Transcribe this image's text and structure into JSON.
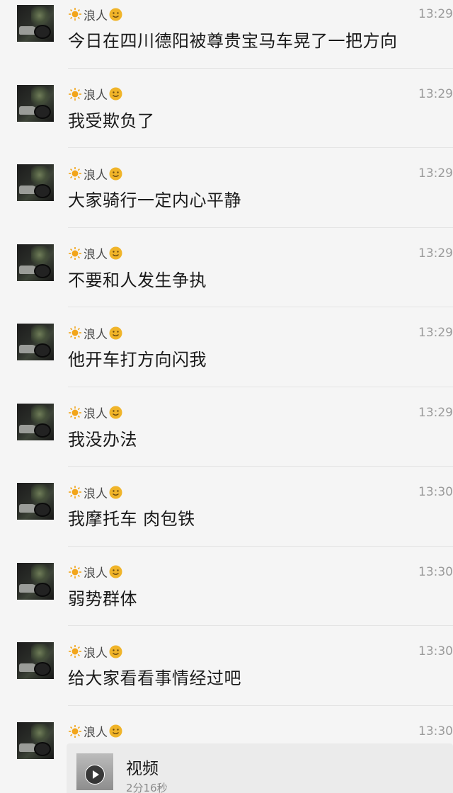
{
  "chat": {
    "sender_name": "浪人",
    "messages": [
      {
        "time": "13:29",
        "text": "今日在四川德阳被尊贵宝马车晃了一把方向"
      },
      {
        "time": "13:29",
        "text": "我受欺负了"
      },
      {
        "time": "13:29",
        "text": "大家骑行一定内心平静"
      },
      {
        "time": "13:29",
        "text": "不要和人发生争执"
      },
      {
        "time": "13:29",
        "text": "他开车打方向闪我"
      },
      {
        "time": "13:29",
        "text": "我没办法"
      },
      {
        "time": "13:30",
        "text": "我摩托车 肉包铁"
      },
      {
        "time": "13:30",
        "text": "弱势群体"
      },
      {
        "time": "13:30",
        "text": "给大家看看事情经过吧"
      },
      {
        "time": "13:30",
        "text": ""
      }
    ],
    "video": {
      "title": "视频",
      "duration": "2分16秒"
    }
  },
  "icons": {
    "name_prefix": "sun-icon",
    "name_suffix": "smile-emoji-icon"
  },
  "colors": {
    "background": "#f5f5f5",
    "sun": "#f2a51a",
    "smile": "#f0b429"
  }
}
